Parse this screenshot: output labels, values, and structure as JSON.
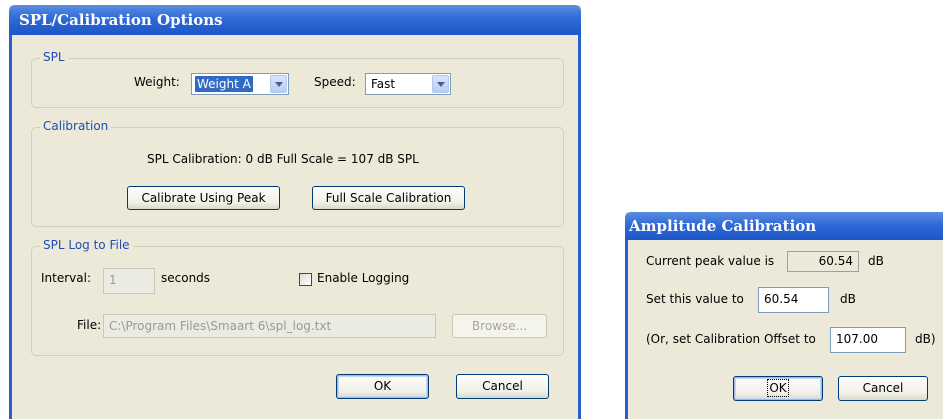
{
  "spl_dialog": {
    "title": "SPL/Calibration Options",
    "spl_group": {
      "label": "SPL",
      "weight_label": "Weight:",
      "weight_value": "Weight A",
      "speed_label": "Speed:",
      "speed_value": "Fast"
    },
    "calibration_group": {
      "label": "Calibration",
      "status_text": "SPL Calibration:  0 dB Full Scale = 107 dB SPL",
      "calibrate_peak_label": "Calibrate Using Peak",
      "full_scale_label": "Full Scale Calibration"
    },
    "log_group": {
      "label": "SPL Log to File",
      "interval_label": "Interval:",
      "interval_value": "1",
      "seconds_label": "seconds",
      "enable_logging_label": "Enable Logging",
      "file_label": "File:",
      "file_value": "C:\\Program Files\\Smaart 6\\spl_log.txt",
      "browse_label": "Browse..."
    },
    "ok_label": "OK",
    "cancel_label": "Cancel"
  },
  "amp_dialog": {
    "title": "Amplitude Calibration",
    "peak_label": "Current peak value is",
    "peak_value": "60.54",
    "peak_unit": "dB",
    "set_label": "Set this value to",
    "set_value": "60.54",
    "set_unit": "dB",
    "offset_label": "(Or, set Calibration Offset to",
    "offset_value": "107.00",
    "offset_unit": "dB)",
    "ok_label": "OK",
    "cancel_label": "Cancel"
  },
  "colors": {
    "titlebar": "#2f6ad6",
    "dialog_bg": "#ece9d8",
    "group_label": "#1f4fb0"
  }
}
